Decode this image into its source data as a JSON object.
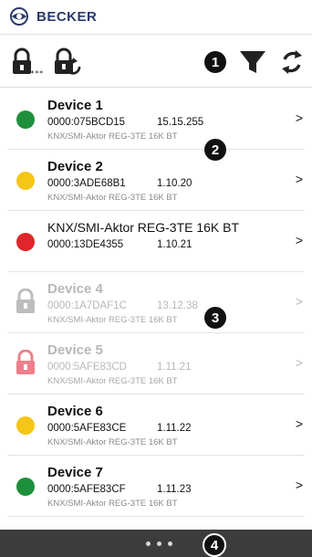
{
  "header": {
    "brand": "BECKER"
  },
  "toolbar": {
    "lock_code_stars": "****",
    "icons": [
      "lock-code-icon",
      "lock-reset-icon",
      "filter-icon",
      "refresh-icon"
    ]
  },
  "callouts": [
    "1",
    "2",
    "3",
    "4"
  ],
  "colors": {
    "green": "#1e8f3a",
    "yellow": "#f5c518",
    "red": "#e0262a",
    "grey_lock": "#bdbdbd",
    "pink_lock": "#ee7f8c",
    "footer": "#3c3c3c"
  },
  "devices": [
    {
      "name": "Device 1",
      "code": "0000:075BCD15",
      "fw": "15.15.255",
      "model": "KNX/SMI-Aktor REG-3TE 16K BT",
      "status": "green",
      "chevron": ">"
    },
    {
      "name": "Device 2",
      "code": "0000:3ADE68B1",
      "fw": "1.10.20",
      "model": "KNX/SMI-Aktor REG-3TE 16K BT",
      "status": "yellow",
      "chevron": ">"
    },
    {
      "name": "KNX/SMI-Aktor REG-3TE 16K BT",
      "code": "0000:13DE4355",
      "fw": "1.10.21",
      "status": "red",
      "chevron": ">"
    },
    {
      "name": "Device 4",
      "code": "0000:1A7DAF1C",
      "fw": "13.12.38",
      "model": "KNX/SMI-Aktor REG-3TE 16K BT",
      "status": "locked-grey",
      "chevron": ">"
    },
    {
      "name": "Device 5",
      "code": "0000:5AFE83CD",
      "fw": "1.11.21",
      "model": "KNX/SMI-Aktor REG-3TE 16K BT",
      "status": "locked-pink",
      "chevron": ">"
    },
    {
      "name": "Device 6",
      "code": "0000:5AFE83CE",
      "fw": "1.11.22",
      "model": "KNX/SMI-Aktor REG-3TE 16K BT",
      "status": "yellow",
      "chevron": ">"
    },
    {
      "name": "Device 7",
      "code": "0000:5AFE83CF",
      "fw": "1.11.23",
      "model": "KNX/SMI-Aktor REG-3TE 16K BT",
      "status": "green",
      "chevron": ">"
    }
  ]
}
